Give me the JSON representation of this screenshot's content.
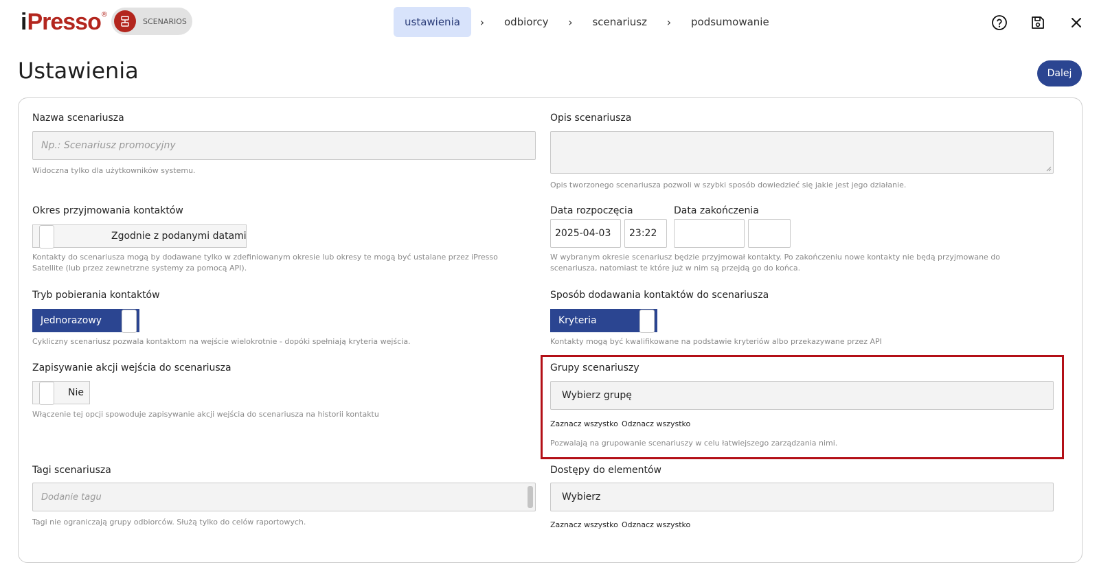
{
  "header": {
    "logo_i": "i",
    "logo_presso": "Presso",
    "logo_reg": "®",
    "module": "SCENARIOS",
    "steps": [
      {
        "label": "ustawienia",
        "active": true
      },
      {
        "label": "odbiorcy",
        "active": false
      },
      {
        "label": "scenariusz",
        "active": false
      },
      {
        "label": "podsumowanie",
        "active": false
      }
    ],
    "step_separator": "›",
    "icons": [
      "help-icon",
      "save-icon",
      "close-icon"
    ]
  },
  "page": {
    "title": "Ustawienia",
    "next_button": "Dalej"
  },
  "form": {
    "name": {
      "label": "Nazwa scenariusza",
      "placeholder": "Np.: Scenariusz promocyjny",
      "value": "",
      "hint": "Widoczna tylko dla użytkowników systemu."
    },
    "description": {
      "label": "Opis scenariusza",
      "value": "",
      "hint": "Opis tworzonego scenariusza pozwoli w szybki sposób dowiedzieć się jakie jest jego działanie."
    },
    "period": {
      "label": "Okres przyjmowania kontaktów",
      "toggle_text": "Zgodnie z podanymi datami",
      "hint": "Kontakty do scenariusza mogą by dodawane tylko w zdefiniowanym okresie lub okresy te mogą być ustalane przez iPresso Satellite (lub przez zewnetrzne systemy za pomocą API)."
    },
    "start": {
      "label": "Data rozpoczęcia",
      "date": "2025-04-03",
      "time": "23:22"
    },
    "end": {
      "label": "Data zakończenia",
      "date": "",
      "time": ""
    },
    "dates_hint": "W wybranym okresie scenariusz będzie przyjmował kontakty. Po zakończeniu nowe kontakty nie będą przyjmowane do scenariusza, natomiast te które już w nim są przejdą go do końca.",
    "mode": {
      "label": "Tryb pobierania kontaktów",
      "toggle_text": "Jednorazowy",
      "hint": "Cykliczny scenariusz pozwala kontaktom na wejście wielokrotnie - dopóki spełniają kryteria wejścia."
    },
    "adding": {
      "label": "Sposób dodawania kontaktów do scenariusza",
      "toggle_text": "Kryteria",
      "hint": "Kontakty mogą być kwalifikowane na podstawie kryteriów albo przekazywane przez API"
    },
    "save_entry": {
      "label": "Zapisywanie akcji wejścia do scenariusza",
      "toggle_text": "Nie",
      "hint": "Włączenie tej opcji spowoduje zapisywanie akcji wejścia do scenariusza na historii kontaktu"
    },
    "groups": {
      "label": "Grupy scenariuszy",
      "placeholder": "Wybierz grupę",
      "select_all": "Zaznacz wszystko",
      "deselect_all": "Odznacz wszystko",
      "hint": "Pozwalają na grupowanie scenariuszy w celu łatwiejszego zarządzania nimi."
    },
    "tags": {
      "label": "Tagi scenariusza",
      "placeholder": "Dodanie tagu",
      "hint": "Tagi nie ograniczają grupy odbiorców. Służą tylko do celów raportowych."
    },
    "access": {
      "label": "Dostępy do elementów",
      "placeholder": "Wybierz",
      "select_all": "Zaznacz wszystko",
      "deselect_all": "Odznacz wszystko"
    }
  },
  "colors": {
    "brand_red": "#b3261e",
    "primary_blue": "#2b4591",
    "active_step": "#d8e3fb",
    "highlight": "#b30f16"
  }
}
